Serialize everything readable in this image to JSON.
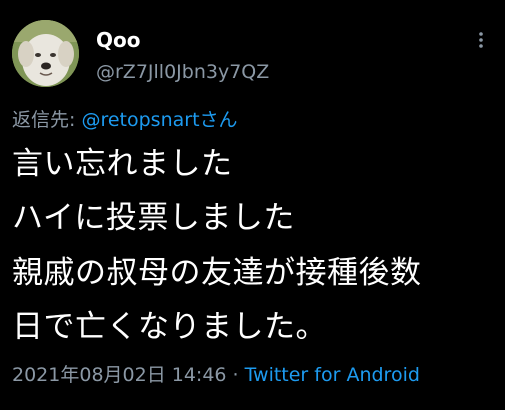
{
  "tweet": {
    "author": {
      "display_name": "Qoo",
      "handle": "@rZ7Jll0Jbn3y7QZ",
      "avatar_icon": "dog-avatar"
    },
    "more_icon": "more-vertical-icon",
    "reply": {
      "prefix": "返信先: ",
      "target": "@retopsnartさん"
    },
    "body_lines": [
      "言い忘れました",
      "ハイに投票しました",
      "親戚の叔母の友達が接種後数",
      "日で亡くなりました。"
    ],
    "timestamp": "2021年08月02日 14:46",
    "separator": "·",
    "source": "Twitter for Android"
  },
  "colors": {
    "background": "#000000",
    "text_primary": "#ffffff",
    "text_secondary": "#8b98a5",
    "link": "#1d9bf0"
  }
}
